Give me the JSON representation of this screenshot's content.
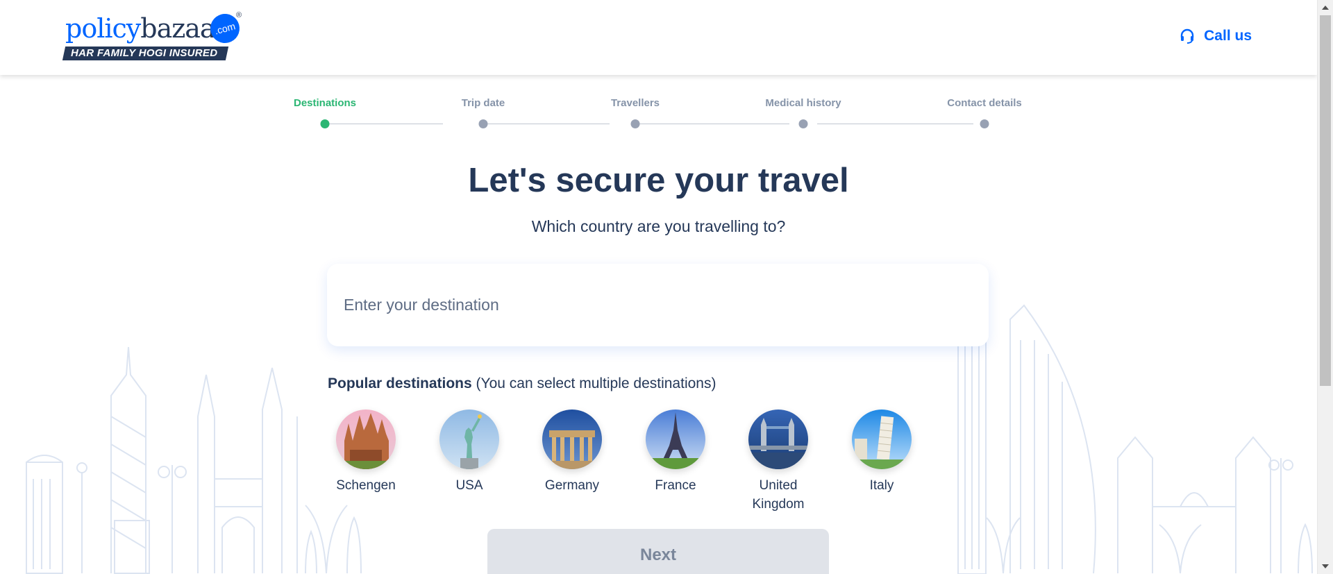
{
  "header": {
    "logo": {
      "word1": "policy",
      "word2": "bazaar",
      "badge": ".com",
      "reg": "®",
      "tagline": "HAR FAMILY HOGI INSURED"
    },
    "call_us": "Call us"
  },
  "stepper": {
    "steps": [
      {
        "label": "Destinations",
        "state": "active"
      },
      {
        "label": "Trip date",
        "state": "pending"
      },
      {
        "label": "Travellers",
        "state": "pending"
      },
      {
        "label": "Medical history",
        "state": "pending"
      },
      {
        "label": "Contact details",
        "state": "pending"
      }
    ]
  },
  "main": {
    "title": "Let's secure your travel",
    "subtitle": "Which country are you travelling to?",
    "destination_input": {
      "placeholder": "Enter your destination",
      "value": ""
    },
    "popular_heading": "Popular destinations",
    "popular_note": "(You can select multiple destinations)",
    "destinations": [
      {
        "name": "Schengen",
        "icon": "sagrada-familia-icon"
      },
      {
        "name": "USA",
        "icon": "statue-of-liberty-icon"
      },
      {
        "name": "Germany",
        "icon": "brandenburg-gate-icon"
      },
      {
        "name": "France",
        "icon": "eiffel-tower-icon"
      },
      {
        "name": "United Kingdom",
        "icon": "tower-bridge-icon"
      },
      {
        "name": "Italy",
        "icon": "leaning-tower-icon"
      }
    ],
    "next_label": "Next"
  },
  "colors": {
    "brand_blue": "#0065ff",
    "navy": "#253858",
    "active_green": "#2bb673",
    "inactive_grey": "#98a1b3"
  }
}
